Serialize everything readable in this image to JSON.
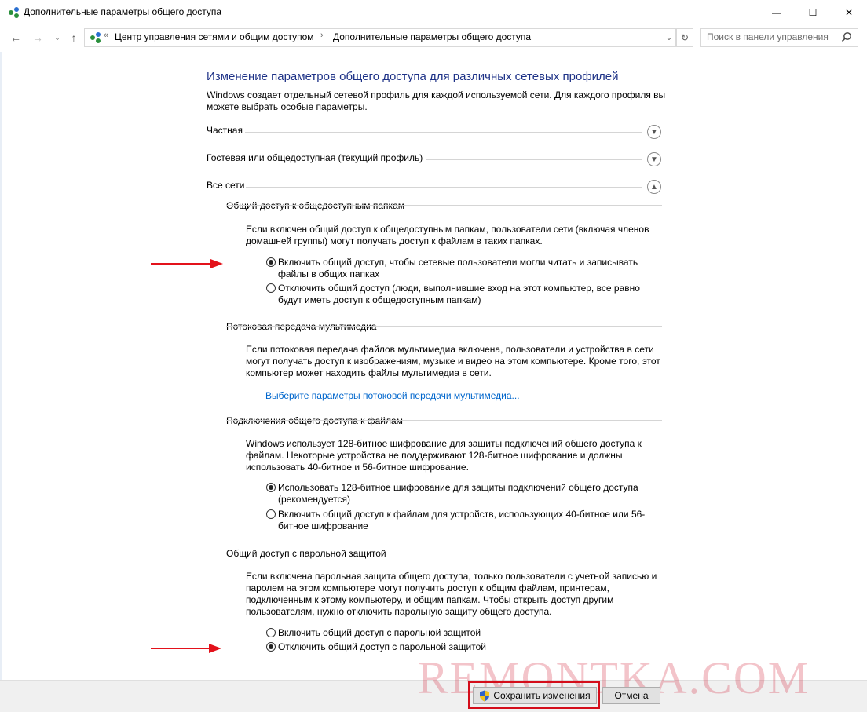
{
  "window": {
    "title": "Дополнительные параметры общего доступа",
    "minimize_glyph": "—",
    "maximize_glyph": "☐",
    "close_glyph": "✕"
  },
  "nav": {
    "back_glyph": "←",
    "forward_glyph": "→",
    "recent_glyph": "⌄",
    "up_glyph": "↑",
    "address_prefix": "«",
    "crumb1": "Центр управления сетями и общим доступом",
    "crumb_sep": "›",
    "crumb2": "Дополнительные параметры общего доступа",
    "dropdown_glyph": "⌄",
    "refresh_glyph": "↻",
    "search_placeholder": "Поиск в панели управления"
  },
  "main": {
    "heading": "Изменение параметров общего доступа для различных сетевых профилей",
    "intro": "Windows создает отдельный сетевой профиль для каждой используемой сети. Для каждого профиля вы можете выбрать особые параметры.",
    "profiles": [
      {
        "label": "Частная",
        "expanded": false
      },
      {
        "label": "Гостевая или общедоступная (текущий профиль)",
        "expanded": false
      },
      {
        "label": "Все сети",
        "expanded": true
      }
    ],
    "public_folders": {
      "title": "Общий доступ к общедоступным папкам",
      "desc": "Если включен общий доступ к общедоступным папкам, пользователи сети (включая членов домашней группы) могут получать доступ к файлам в таких папках.",
      "opt_on": "Включить общий доступ, чтобы сетевые пользователи могли читать и записывать файлы в общих папках",
      "opt_off": "Отключить общий доступ (люди, выполнившие вход на этот компьютер, все равно будут иметь доступ к общедоступным папкам)",
      "selected": "on"
    },
    "media": {
      "title": "Потоковая передача мультимедиа",
      "desc": "Если потоковая передача файлов мультимедиа включена, пользователи и устройства в сети могут получать доступ к изображениям, музыке и видео на этом компьютере. Кроме того, этот компьютер может находить файлы мультимедиа в сети.",
      "link": "Выберите параметры потоковой передачи мультимедиа..."
    },
    "file_sharing": {
      "title": "Подключения общего доступа к файлам",
      "desc": "Windows использует 128-битное шифрование для защиты подключений общего доступа к файлам. Некоторые устройства не поддерживают 128-битное шифрование и должны использовать 40-битное и 56-битное шифрование.",
      "opt_128": "Использовать 128-битное шифрование для защиты подключений общего доступа (рекомендуется)",
      "opt_40": "Включить общий доступ к файлам для устройств, использующих 40-битное или 56-битное шифрование",
      "selected": "128"
    },
    "password": {
      "title": "Общий доступ с парольной защитой",
      "desc": "Если включена парольная защита общего доступа, только пользователи с учетной записью и паролем на этом компьютере могут получить доступ к общим файлам, принтерам, подключенным к этому компьютеру, и общим папкам. Чтобы открыть доступ другим пользователям, нужно отключить парольную защиту общего доступа.",
      "opt_on": "Включить общий доступ с парольной защитой",
      "opt_off": "Отключить общий доступ с парольной защитой",
      "selected": "off"
    }
  },
  "footer": {
    "save_label": "Сохранить изменения",
    "cancel_label": "Отмена"
  },
  "watermark": "REMONTKA.COM",
  "colors": {
    "heading": "#1e3287",
    "link": "#0066cc",
    "annotation_red": "#e3121b"
  }
}
